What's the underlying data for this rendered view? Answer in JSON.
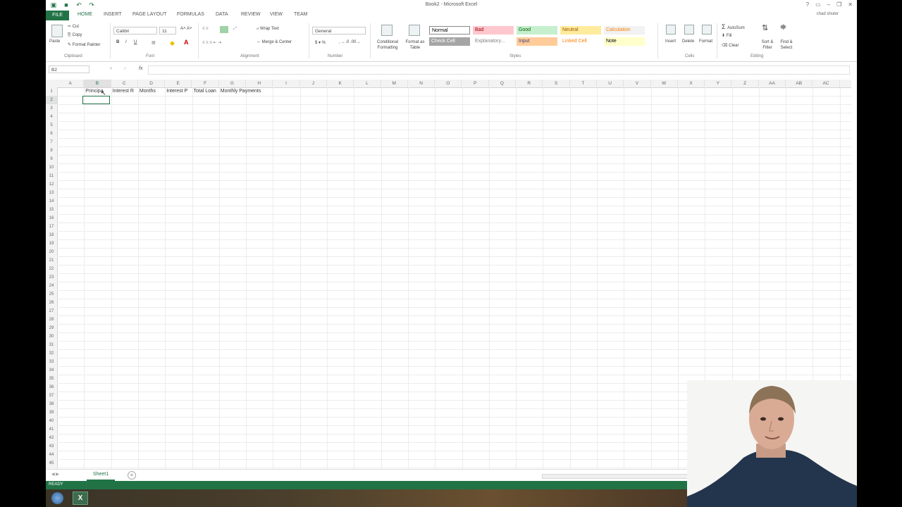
{
  "window": {
    "title": "Book2 - Microsoft Excel",
    "user": "chad shuter"
  },
  "tabs": [
    "FILE",
    "HOME",
    "INSERT",
    "PAGE LAYOUT",
    "FORMULAS",
    "DATA",
    "REVIEW",
    "VIEW",
    "TEAM"
  ],
  "ribbon": {
    "clipboard": {
      "paste": "Paste",
      "cut": "Cut",
      "copy": "Copy",
      "format_painter": "Format Painter",
      "label": "Clipboard"
    },
    "font": {
      "name": "Calibri",
      "size": "11",
      "label": "Font"
    },
    "alignment": {
      "wrap_text": "Wrap Text",
      "merge_center": "Merge & Center",
      "label": "Alignment"
    },
    "number": {
      "format": "General",
      "label": "Number"
    },
    "styles": {
      "conditional": "Conditional Formatting",
      "format_as_table": "Format as Table",
      "cells": [
        {
          "name": "Normal",
          "bg": "#ffffff",
          "fg": "#000000"
        },
        {
          "name": "Bad",
          "bg": "#ffc7ce",
          "fg": "#9c0006"
        },
        {
          "name": "Good",
          "bg": "#c6efce",
          "fg": "#006100"
        },
        {
          "name": "Neutral",
          "bg": "#ffeb9c",
          "fg": "#9c5700"
        },
        {
          "name": "Calculation",
          "bg": "#f2f2f2",
          "fg": "#fa7d00"
        },
        {
          "name": "Check Cell",
          "bg": "#a5a5a5",
          "fg": "#ffffff"
        },
        {
          "name": "Explanatory...",
          "bg": "#ffffff",
          "fg": "#7f7f7f"
        },
        {
          "name": "Input",
          "bg": "#ffcc99",
          "fg": "#3f3f76"
        },
        {
          "name": "Linked Cell",
          "bg": "#ffffff",
          "fg": "#fa7d00"
        },
        {
          "name": "Note",
          "bg": "#ffffcc",
          "fg": "#000000"
        }
      ],
      "label": "Styles"
    },
    "cells": {
      "insert": "Insert",
      "delete": "Delete",
      "format": "Format",
      "label": "Cells"
    },
    "editing": {
      "autosum": "AutoSum",
      "fill": "Fill",
      "clear": "Clear",
      "sort_filter": "Sort & Filter",
      "find_select": "Find & Select",
      "label": "Editing"
    }
  },
  "formula_bar": {
    "name_box": "B2",
    "fx": "fx",
    "value": ""
  },
  "columns": [
    "A",
    "B",
    "C",
    "D",
    "E",
    "F",
    "G",
    "H",
    "I",
    "J",
    "K",
    "L",
    "M",
    "N",
    "O",
    "P",
    "Q",
    "R",
    "S",
    "T",
    "U",
    "V",
    "W",
    "X",
    "Y",
    "Z",
    "AA",
    "AB",
    "AC"
  ],
  "rows": [
    "1",
    "2",
    "3",
    "4",
    "5",
    "6",
    "7",
    "8",
    "9",
    "10",
    "11",
    "12",
    "13",
    "14",
    "15",
    "16",
    "17",
    "18",
    "19",
    "20",
    "21",
    "22",
    "23",
    "24",
    "25",
    "26",
    "27",
    "28",
    "29",
    "30",
    "31",
    "32",
    "33",
    "34",
    "35",
    "36",
    "37",
    "38",
    "39",
    "40",
    "41",
    "42",
    "43",
    "44",
    "45"
  ],
  "cells": {
    "B1": "Principa",
    "C1": "Interest R",
    "D1": "Months",
    "E1": "Interest P",
    "F1": "Total Loan",
    "G1": "Monthly Payments"
  },
  "sheet": {
    "tab": "Sheet1",
    "add": "+"
  },
  "status": {
    "text": "READY"
  },
  "colors": {
    "excel_green": "#217346"
  }
}
